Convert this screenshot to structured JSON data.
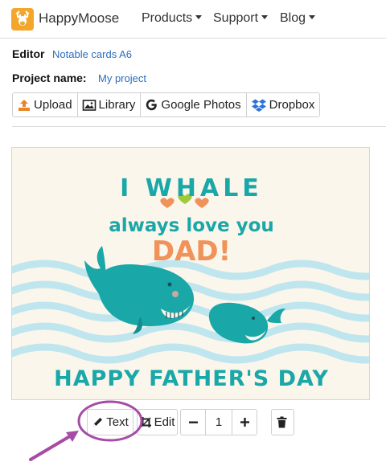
{
  "navbar": {
    "brand": "HappyMoose",
    "items": [
      {
        "label": "Products"
      },
      {
        "label": "Support"
      },
      {
        "label": "Blog"
      }
    ]
  },
  "editor": {
    "label": "Editor",
    "product": "Notable cards A6"
  },
  "project": {
    "label": "Project name:",
    "name": "My project"
  },
  "upload_toolbar": {
    "upload": "Upload",
    "library": "Library",
    "google_photos": "Google Photos",
    "dropbox": "Dropbox"
  },
  "card": {
    "line1": "I WHALE",
    "line2": "always love you",
    "line3": "DAD!",
    "line4": "HAPPY FATHER'S DAY"
  },
  "controls": {
    "text_button": "Text",
    "edit_button": "Edit",
    "quantity": "1"
  },
  "colors": {
    "accent": "#f4a62a",
    "link": "#2a6ebb",
    "teal": "#1aa7a8",
    "coral": "#f0935a",
    "annotation": "#a64ca6"
  }
}
